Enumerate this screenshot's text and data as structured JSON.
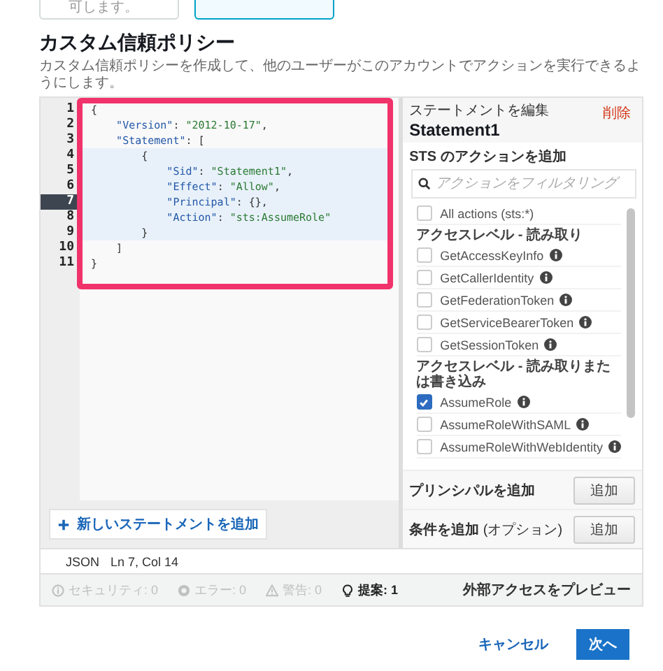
{
  "top_cards": [
    {
      "text": "可します。",
      "selected": false
    },
    {
      "selected": true
    }
  ],
  "section": {
    "title": "カスタム信頼ポリシー",
    "description": "カスタム信頼ポリシーを作成して、他のユーザーがこのアカウントでアクションを実行できるようにします。"
  },
  "editor": {
    "lines": [
      {
        "number": "1",
        "highlighted": false,
        "current": false,
        "tokens": [
          {
            "kind": "plain",
            "text": "{"
          }
        ]
      },
      {
        "number": "2",
        "highlighted": false,
        "current": false,
        "tokens": [
          {
            "kind": "key",
            "text": "    \"Version\""
          },
          {
            "kind": "plain",
            "text": ": "
          },
          {
            "kind": "string",
            "text": "\"2012-10-17\""
          },
          {
            "kind": "plain",
            "text": ","
          }
        ]
      },
      {
        "number": "3",
        "highlighted": false,
        "current": false,
        "tokens": [
          {
            "kind": "key",
            "text": "    \"Statement\""
          },
          {
            "kind": "plain",
            "text": ": ["
          }
        ]
      },
      {
        "number": "4",
        "highlighted": true,
        "current": false,
        "tokens": [
          {
            "kind": "plain",
            "text": "        {"
          }
        ]
      },
      {
        "number": "5",
        "highlighted": true,
        "current": false,
        "tokens": [
          {
            "kind": "key",
            "text": "            \"Sid\""
          },
          {
            "kind": "plain",
            "text": ": "
          },
          {
            "kind": "string",
            "text": "\"Statement1\""
          },
          {
            "kind": "plain",
            "text": ","
          }
        ]
      },
      {
        "number": "6",
        "highlighted": true,
        "current": false,
        "tokens": [
          {
            "kind": "key",
            "text": "            \"Effect\""
          },
          {
            "kind": "plain",
            "text": ": "
          },
          {
            "kind": "string",
            "text": "\"Allow\""
          },
          {
            "kind": "plain",
            "text": ","
          }
        ]
      },
      {
        "number": "7",
        "highlighted": true,
        "current": true,
        "tokens": [
          {
            "kind": "key",
            "text": "            \"Principal\""
          },
          {
            "kind": "plain",
            "text": ": {},"
          }
        ]
      },
      {
        "number": "8",
        "highlighted": true,
        "current": false,
        "tokens": [
          {
            "kind": "key",
            "text": "            \"Action\""
          },
          {
            "kind": "plain",
            "text": ": "
          },
          {
            "kind": "string",
            "text": "\"sts:AssumeRole\""
          }
        ]
      },
      {
        "number": "9",
        "highlighted": true,
        "current": false,
        "tokens": [
          {
            "kind": "plain",
            "text": "        }"
          }
        ]
      },
      {
        "number": "10",
        "highlighted": false,
        "current": false,
        "tokens": [
          {
            "kind": "plain",
            "text": "    ]"
          }
        ]
      },
      {
        "number": "11",
        "highlighted": false,
        "current": false,
        "tokens": [
          {
            "kind": "plain",
            "text": "}"
          }
        ]
      }
    ],
    "add_statement_button": "新しいステートメントを追加",
    "status": {
      "language": "JSON",
      "position": "Ln 7, Col 14"
    }
  },
  "statement_panel": {
    "heading": "ステートメントを編集",
    "name": "Statement1",
    "delete_link": "削除",
    "actions_title": "STS のアクションを追加",
    "filter": {
      "placeholder": "アクションをフィルタリング"
    },
    "actions": [
      {
        "kind": "checkbox",
        "text": "All actions (sts:*)",
        "checked": false,
        "info": false
      },
      {
        "kind": "heading",
        "text": "アクセスレベル - 読み取り"
      },
      {
        "kind": "checkbox",
        "text": "GetAccessKeyInfo",
        "checked": false,
        "info": true
      },
      {
        "kind": "checkbox",
        "text": "GetCallerIdentity",
        "checked": false,
        "info": true
      },
      {
        "kind": "checkbox",
        "text": "GetFederationToken",
        "checked": false,
        "info": true
      },
      {
        "kind": "checkbox",
        "text": "GetServiceBearerToken",
        "checked": false,
        "info": true
      },
      {
        "kind": "checkbox",
        "text": "GetSessionToken",
        "checked": false,
        "info": true
      },
      {
        "kind": "heading",
        "text": "アクセスレベル - 読み取りまたは書き込み"
      },
      {
        "kind": "checkbox",
        "text": "AssumeRole",
        "checked": true,
        "info": true
      },
      {
        "kind": "checkbox",
        "text": "AssumeRoleWithSAML",
        "checked": false,
        "info": true
      },
      {
        "kind": "checkbox",
        "text": "AssumeRoleWithWebIdentity",
        "checked": false,
        "info": true
      }
    ],
    "rows": [
      {
        "label": "**プリンシパルを追加**",
        "button": "追加"
      },
      {
        "label": "**条件を追加** (オプション)",
        "button": "追加"
      }
    ]
  },
  "checks_bar": {
    "items": [
      {
        "kind": "security",
        "text": "セキュリティ: 0",
        "disabled": true
      },
      {
        "kind": "error",
        "text": "エラー: 0",
        "disabled": true
      },
      {
        "kind": "warning",
        "text": "警告: 0",
        "disabled": true
      },
      {
        "kind": "suggestion",
        "text": "提案: 1",
        "disabled": false
      }
    ],
    "preview_link": "外部アクセスをプレビュー"
  },
  "footer": {
    "cancel": "キャンセル",
    "next": "次へ"
  }
}
